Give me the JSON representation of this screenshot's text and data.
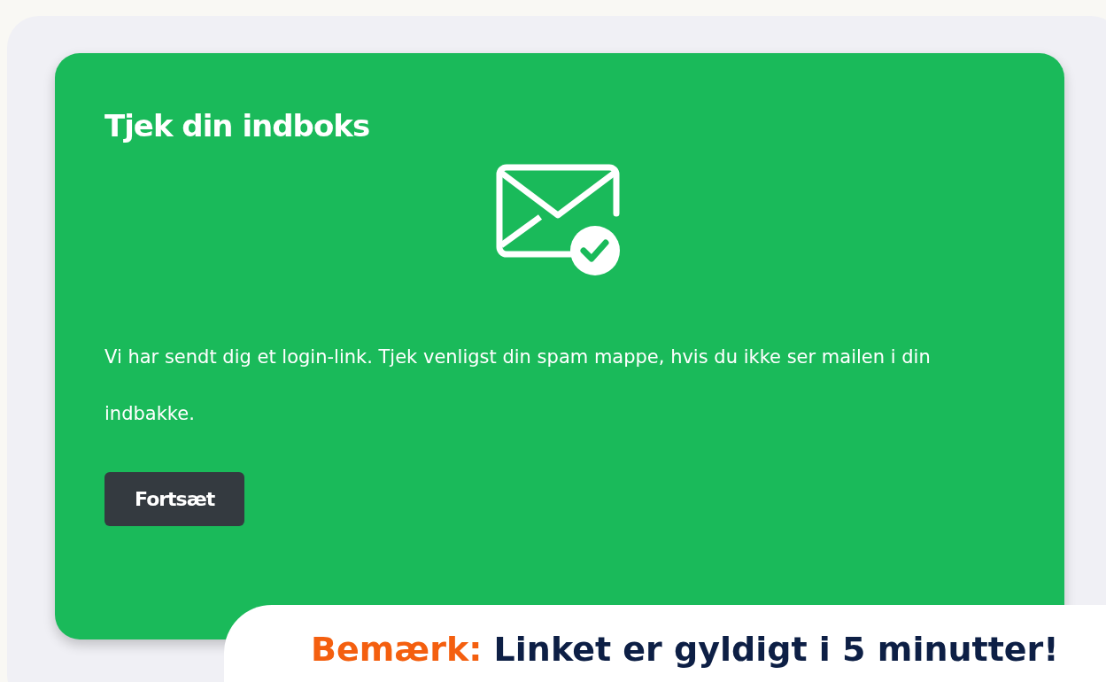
{
  "card": {
    "title": "Tjek din indboks",
    "message": "Vi har sendt dig et login-link. Tjek venligst din spam mappe, hvis du ikke ser mailen i din indbakke.",
    "button": "Fortsæt"
  },
  "note": {
    "label": "Bemærk:",
    "text": "Linket er gyldigt i 5 minutter!"
  }
}
